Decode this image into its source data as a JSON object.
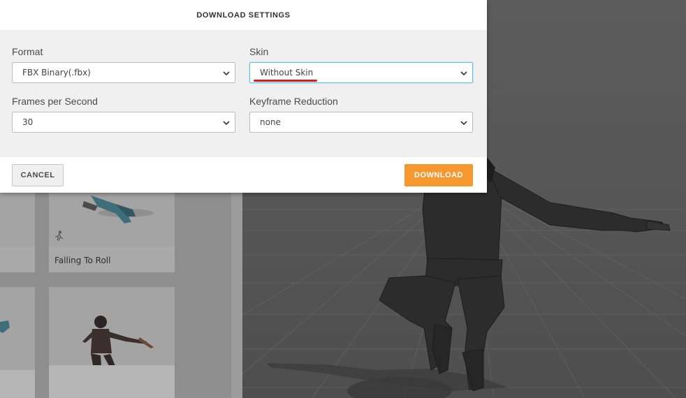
{
  "dialog": {
    "title": "DOWNLOAD SETTINGS",
    "fields": {
      "format": {
        "label": "Format",
        "value": "FBX Binary(.fbx)"
      },
      "skin": {
        "label": "Skin",
        "value": "Without Skin"
      },
      "fps": {
        "label": "Frames per Second",
        "value": "30"
      },
      "keyframe": {
        "label": "Keyframe Reduction",
        "value": "none"
      }
    },
    "cancel_label": "CANCEL",
    "download_label": "DOWNLOAD"
  },
  "library": {
    "cards": [
      {
        "label": "Falling To Roll"
      }
    ]
  },
  "colors": {
    "accent": "#f7972f",
    "focus": "#5fc1da",
    "annotation": "#d31f1f"
  },
  "icons": [
    "chevron-down-icon",
    "run-icon"
  ]
}
